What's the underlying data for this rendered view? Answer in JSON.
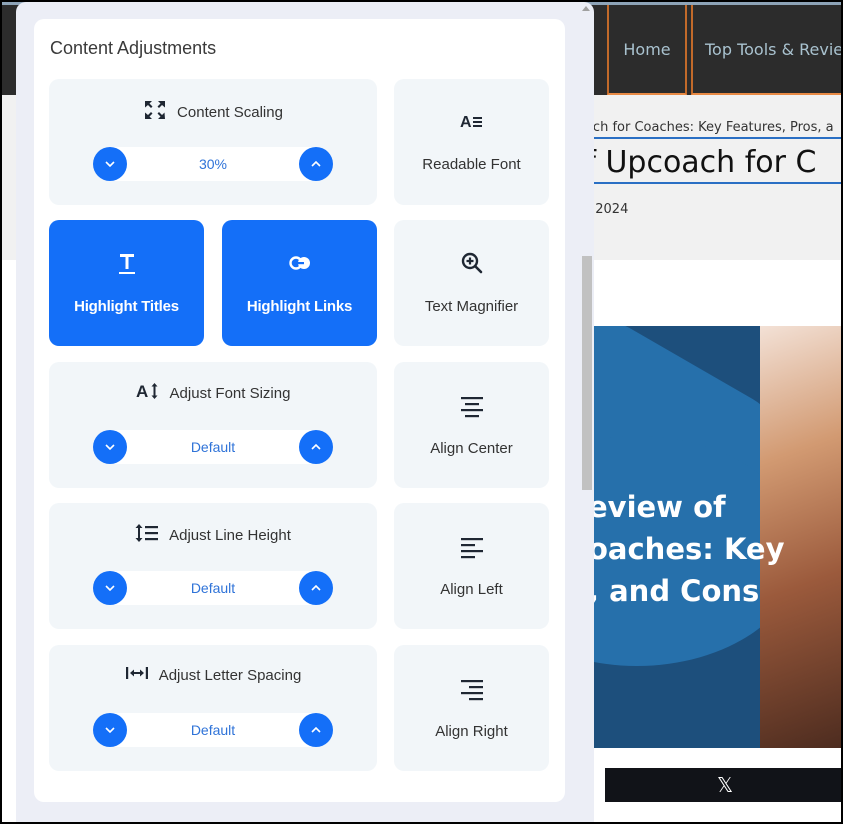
{
  "background_site": {
    "nav": [
      {
        "label": "Home"
      },
      {
        "label": "Top Tools & Reviews"
      }
    ],
    "breadcrumb": "oach for Coaches: Key Features, Pros, a",
    "post_title": "of Upcoach for C",
    "post_date": ", 2024",
    "feature_image_text": "eview of\noaches: Key\n, and Cons",
    "share_x_label": "𝕏"
  },
  "panel": {
    "title": "Content Adjustments",
    "accent_color": "#146ff8",
    "steppers": [
      {
        "id": "content-scaling",
        "label": "Content Scaling",
        "icon": "expand-arrows-icon",
        "value": "30%"
      },
      {
        "id": "font-sizing",
        "label": "Adjust Font Sizing",
        "icon": "font-size-icon",
        "value": "Default"
      },
      {
        "id": "line-height",
        "label": "Adjust Line Height",
        "icon": "line-height-icon",
        "value": "Default"
      },
      {
        "id": "letter-spacing",
        "label": "Adjust Letter Spacing",
        "icon": "letter-spacing-icon",
        "value": "Default"
      }
    ],
    "toggles": [
      {
        "id": "readable-font",
        "label": "Readable Font",
        "icon": "readable-font-icon",
        "active": false
      },
      {
        "id": "highlight-titles",
        "label": "Highlight Titles",
        "icon": "title-icon",
        "active": true
      },
      {
        "id": "highlight-links",
        "label": "Highlight Links",
        "icon": "link-icon",
        "active": true
      },
      {
        "id": "text-magnifier",
        "label": "Text Magnifier",
        "icon": "magnifier-icon",
        "active": false
      },
      {
        "id": "align-center",
        "label": "Align Center",
        "icon": "align-center-icon",
        "active": false
      },
      {
        "id": "align-left",
        "label": "Align Left",
        "icon": "align-left-icon",
        "active": false
      },
      {
        "id": "align-right",
        "label": "Align Right",
        "icon": "align-right-icon",
        "active": false
      }
    ]
  }
}
